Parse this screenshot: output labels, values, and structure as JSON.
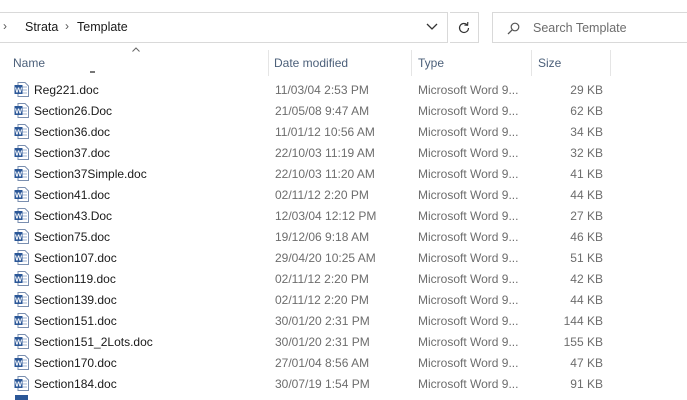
{
  "address_bar": {
    "breadcrumbs": [
      "Strata",
      "Template"
    ]
  },
  "search": {
    "placeholder": "Search Template"
  },
  "columns": {
    "name": "Name",
    "date": "Date modified",
    "type": "Type",
    "size": "Size"
  },
  "files": [
    {
      "name": "Reg221.doc",
      "date": "11/03/04 2:53 PM",
      "type": "Microsoft Word 9...",
      "size": "29 KB"
    },
    {
      "name": "Section26.Doc",
      "date": "21/05/08 9:47 AM",
      "type": "Microsoft Word 9...",
      "size": "62 KB"
    },
    {
      "name": "Section36.doc",
      "date": "11/01/12 10:56 AM",
      "type": "Microsoft Word 9...",
      "size": "34 KB"
    },
    {
      "name": "Section37.doc",
      "date": "22/10/03 11:19 AM",
      "type": "Microsoft Word 9...",
      "size": "32 KB"
    },
    {
      "name": "Section37Simple.doc",
      "date": "22/10/03 11:20 AM",
      "type": "Microsoft Word 9...",
      "size": "41 KB"
    },
    {
      "name": "Section41.doc",
      "date": "02/11/12 2:20 PM",
      "type": "Microsoft Word 9...",
      "size": "44 KB"
    },
    {
      "name": "Section43.Doc",
      "date": "12/03/04 12:12 PM",
      "type": "Microsoft Word 9...",
      "size": "27 KB"
    },
    {
      "name": "Section75.doc",
      "date": "19/12/06 9:18 AM",
      "type": "Microsoft Word 9...",
      "size": "46 KB"
    },
    {
      "name": "Section107.doc",
      "date": "29/04/20 10:25 AM",
      "type": "Microsoft Word 9...",
      "size": "51 KB"
    },
    {
      "name": "Section119.doc",
      "date": "02/11/12 2:20 PM",
      "type": "Microsoft Word 9...",
      "size": "42 KB"
    },
    {
      "name": "Section139.doc",
      "date": "02/11/12 2:20 PM",
      "type": "Microsoft Word 9...",
      "size": "44 KB"
    },
    {
      "name": "Section151.doc",
      "date": "30/01/20 2:31 PM",
      "type": "Microsoft Word 9...",
      "size": "144 KB"
    },
    {
      "name": "Section151_2Lots.doc",
      "date": "30/01/20 2:31 PM",
      "type": "Microsoft Word 9...",
      "size": "155 KB"
    },
    {
      "name": "Section170.doc",
      "date": "27/01/04 8:56 AM",
      "type": "Microsoft Word 9...",
      "size": "47 KB"
    },
    {
      "name": "Section184.doc",
      "date": "30/07/19 1:54 PM",
      "type": "Microsoft Word 9...",
      "size": "91 KB"
    }
  ],
  "icons": {
    "chevron": "chevron-right-icon",
    "dropdown": "chevron-down-icon",
    "refresh": "refresh-icon",
    "search": "search-icon",
    "file": "word-document-icon"
  },
  "colors": {
    "header_text": "#4c607a",
    "word_blue": "#2b5797",
    "meta_text": "#6d6d6d"
  }
}
